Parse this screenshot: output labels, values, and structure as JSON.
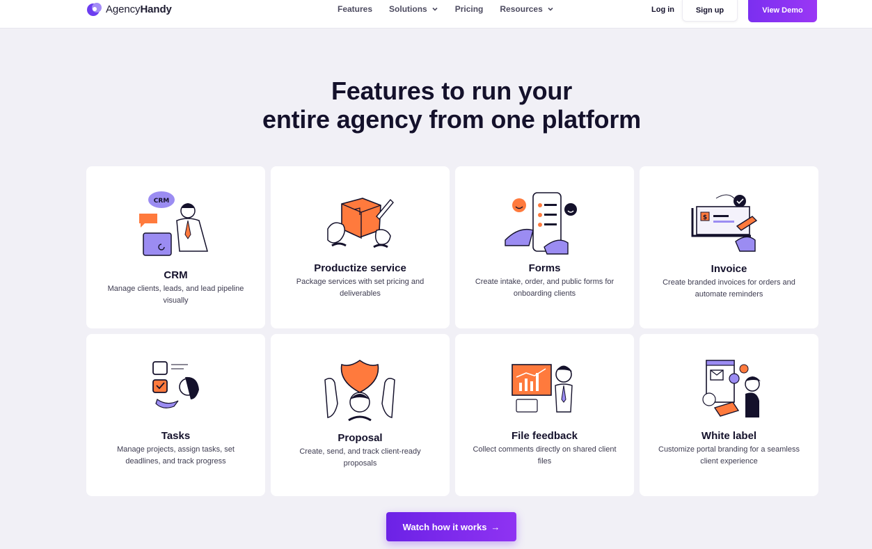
{
  "nav": {
    "logo_prefix": "Agency",
    "logo_suffix": "Handy",
    "menu": [
      {
        "label": "Features"
      },
      {
        "label": "Solutions"
      },
      {
        "label": "Pricing"
      },
      {
        "label": "Resources"
      }
    ],
    "login": "Log in",
    "signup": "Sign up",
    "demo": "View Demo"
  },
  "hero": {
    "line1": "Features to run your",
    "line2": "entire agency from one platform"
  },
  "features": [
    {
      "title": "CRM",
      "desc": "Manage clients, leads, and lead pipeline visually",
      "badge": "CRM"
    },
    {
      "title": "Productize service",
      "desc": "Package services with set pricing and deliverables"
    },
    {
      "title": "Forms",
      "desc": "Create intake, order, and public forms for onboarding clients"
    },
    {
      "title": "Invoice",
      "desc": "Create branded invoices for orders and automate reminders",
      "badge": "$"
    },
    {
      "title": "Tasks",
      "desc": "Manage projects, assign tasks, set deadlines, and track progress"
    },
    {
      "title": "Proposal",
      "desc": "Create, send, and track client-ready proposals"
    },
    {
      "title": "File feedback",
      "desc": "Collect comments directly on shared client files"
    },
    {
      "title": "White label",
      "desc": "Customize portal branding for a seamless client experience"
    }
  ],
  "cta": {
    "label": "Watch how it works",
    "arrow": "→"
  },
  "colors": {
    "accent": "#7b2ff0",
    "orange": "#ff7a3d",
    "lavender": "#9b8cf2",
    "ink": "#14112b"
  }
}
